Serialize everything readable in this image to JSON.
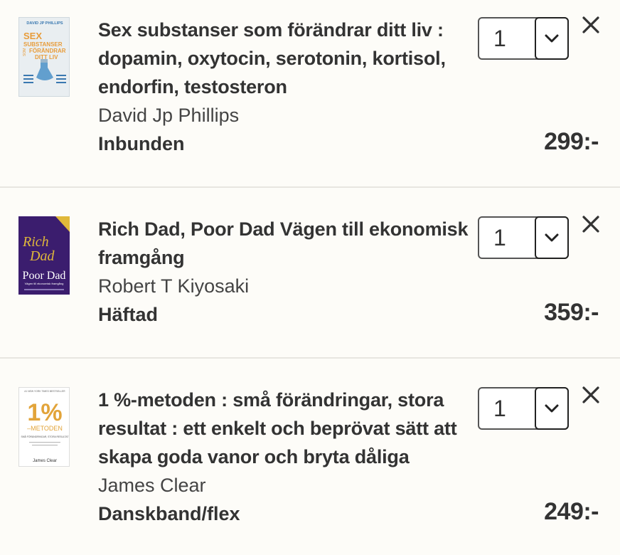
{
  "cart": {
    "items": [
      {
        "title": "Sex substanser som förändrar ditt liv : dopamin, oxytocin, serotonin, kortisol, endorfin, testosteron",
        "author": "David Jp Phillips",
        "format": "Inbunden",
        "quantity": "1",
        "price": "299:-",
        "cover": {
          "author_line": "DAVID JP PHILLIPS",
          "line1": "SEX",
          "line2": "SUBSTANSER",
          "line3": "FÖRÄNDRAR",
          "line4": "DITT LIV",
          "side": "SOM",
          "bg_color": "#e9eef1",
          "accent_color": "#e89c3a"
        }
      },
      {
        "title": "Rich Dad, Poor Dad Vägen till ekonomisk framgång",
        "author": "Robert T Kiyosaki",
        "format": "Häftad",
        "quantity": "1",
        "price": "359:-",
        "cover": {
          "line1": "Rich",
          "line2": "Dad",
          "line3": "Poor Dad",
          "line4": "Vägen till ekonomisk framgång",
          "bg_color": "#3b1d6e",
          "accent_color": "#e0b83a"
        }
      },
      {
        "title": "1 %-metoden : små förändringar, stora resultat : ett enkelt och beprövat sätt att skapa goda vanor och bryta dåliga",
        "author": "James Clear",
        "format": "Danskband/flex",
        "quantity": "1",
        "price": "249:-",
        "cover": {
          "top": "#1 NEW YORK TIMES BESTSELLER",
          "line1": "1%",
          "line2": "–METODEN",
          "line3": "SMÅ FÖRÄNDRINGAR, STORA RESULTAT",
          "author_line": "James Clear",
          "bg_color": "#ffffff",
          "accent_color": "#e2a43a"
        }
      }
    ]
  },
  "icons": {
    "dropdown": "chevron-down-icon",
    "remove": "close-icon"
  }
}
